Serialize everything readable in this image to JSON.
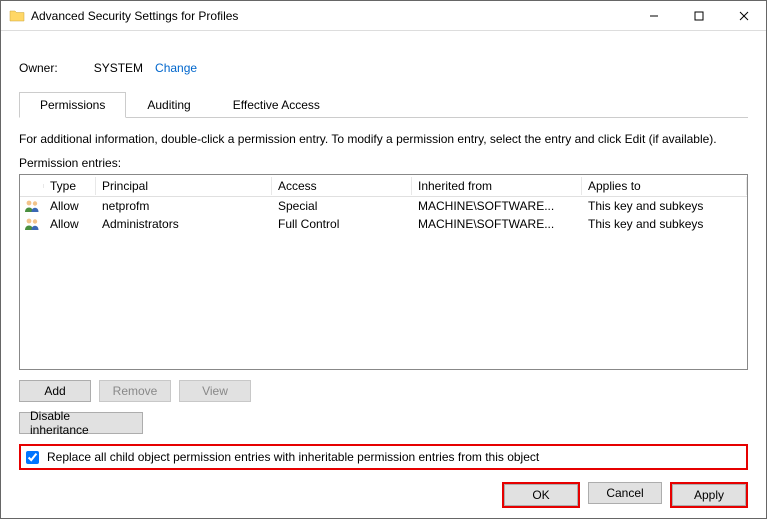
{
  "window": {
    "title": "Advanced Security Settings for Profiles"
  },
  "owner": {
    "label": "Owner:",
    "value": "SYSTEM",
    "change": "Change"
  },
  "tabs": {
    "permissions": "Permissions",
    "auditing": "Auditing",
    "effective": "Effective Access"
  },
  "instructions": "For additional information, double-click a permission entry. To modify a permission entry, select the entry and click Edit (if available).",
  "entries_label": "Permission entries:",
  "columns": {
    "type": "Type",
    "principal": "Principal",
    "access": "Access",
    "inherited": "Inherited from",
    "applies": "Applies to"
  },
  "rows": [
    {
      "type": "Allow",
      "principal": "netprofm",
      "access": "Special",
      "inherited": "MACHINE\\SOFTWARE...",
      "applies": "This key and subkeys"
    },
    {
      "type": "Allow",
      "principal": "Administrators",
      "access": "Full Control",
      "inherited": "MACHINE\\SOFTWARE...",
      "applies": "This key and subkeys"
    }
  ],
  "buttons": {
    "add": "Add",
    "remove": "Remove",
    "view": "View",
    "disable_inherit": "Disable inheritance",
    "ok": "OK",
    "cancel": "Cancel",
    "apply": "Apply"
  },
  "checkbox_label": "Replace all child object permission entries with inheritable permission entries from this object"
}
